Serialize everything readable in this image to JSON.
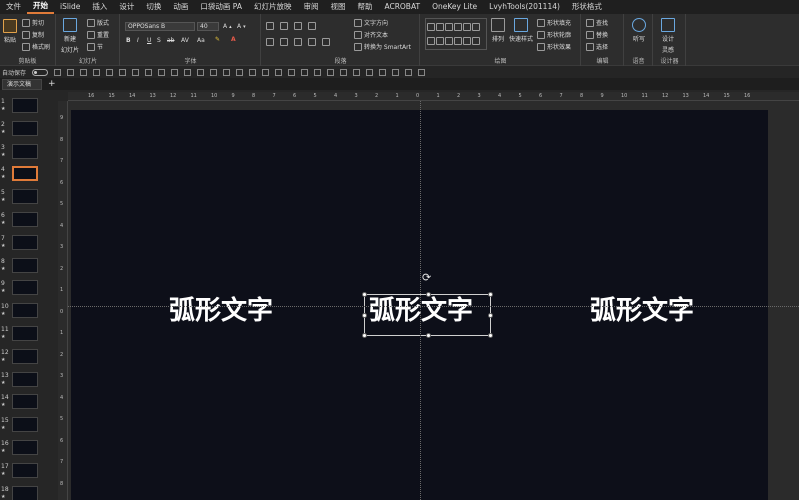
{
  "menu": {
    "tabs": [
      "文件",
      "开始",
      "iSlide",
      "插入",
      "设计",
      "切换",
      "动画",
      "口袋动画 PA",
      "幻灯片放映",
      "审阅",
      "视图",
      "帮助",
      "ACROBAT",
      "OneKey Lite",
      "LvyhTools(201114)",
      "形状格式"
    ],
    "active_index": 1
  },
  "ribbon": {
    "clipboard": {
      "paste": "粘贴",
      "cut": "剪切",
      "copy": "复制",
      "format_painter": "格式刷",
      "label": "剪贴板"
    },
    "slides": {
      "new_slide": "新建",
      "new_slide2": "幻灯片",
      "layout": "版式",
      "reset": "重置",
      "section": "节",
      "label": "幻灯片"
    },
    "font": {
      "font_name": "OPPOSans B",
      "font_size": "40",
      "label": "字体"
    },
    "paragraph": {
      "text_direction": "文字方向",
      "align_text": "对齐文本",
      "smartart": "转换为 SmartArt",
      "label": "段落"
    },
    "drawing": {
      "arrange": "排列",
      "quick_styles": "快速样式",
      "shape_fill": "形状填充",
      "shape_outline": "形状轮廓",
      "shape_effects": "形状效果",
      "label": "绘图"
    },
    "editing": {
      "find": "查找",
      "replace": "替换",
      "select": "选择",
      "label": "编辑"
    },
    "voice": {
      "dictate": "听写",
      "label": "语音"
    },
    "designer": {
      "designer_line1": "设计",
      "designer_line2": "灵感",
      "label": "设计器"
    }
  },
  "qat": {
    "autosave": "自动保存"
  },
  "document": {
    "tab_label": "演示文稿"
  },
  "ruler": {
    "h_labels": [
      "16",
      "15",
      "14",
      "13",
      "12",
      "11",
      "10",
      "9",
      "8",
      "7",
      "6",
      "5",
      "4",
      "3",
      "2",
      "1",
      "0",
      "1",
      "2",
      "3",
      "4",
      "5",
      "6",
      "7",
      "8",
      "9",
      "10",
      "11",
      "12",
      "13",
      "14",
      "15",
      "16"
    ],
    "v_labels": [
      "9",
      "8",
      "7",
      "6",
      "5",
      "4",
      "3",
      "2",
      "1",
      "0",
      "1",
      "2",
      "3",
      "4",
      "5",
      "6",
      "7",
      "8",
      "9"
    ]
  },
  "slides": {
    "thumbnails": [
      "1",
      "2",
      "3",
      "4",
      "5",
      "6",
      "7",
      "8",
      "9",
      "10",
      "11",
      "12",
      "13",
      "14",
      "15",
      "16",
      "17",
      "18"
    ],
    "selected": 3
  },
  "slide": {
    "text_left": "弧形文字",
    "text_center": "弧形文字",
    "text_right": "弧形文字",
    "background_color": "#0d0f19"
  },
  "colors": {
    "accent": "#e07b39",
    "ribbon_bg": "#2d2d2d"
  }
}
